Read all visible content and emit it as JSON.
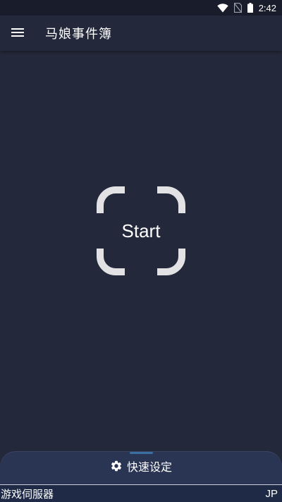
{
  "status_bar": {
    "time": "2:42",
    "icons": [
      "wifi-icon",
      "no-sim-icon",
      "battery-icon"
    ]
  },
  "app_bar": {
    "menu_icon": "hamburger-menu-icon",
    "title": "马娘事件簿"
  },
  "main": {
    "start_label": "Start",
    "frame_icon": "scan-frame-icon"
  },
  "bottom_sheet": {
    "quick_settings_icon": "gear-icon",
    "quick_settings_label": "快速设定",
    "server_label": "游戏伺服器",
    "server_value": "JP"
  },
  "colors": {
    "background": "#23283a",
    "status_bar": "#191d2b",
    "sheet": "#2a3553",
    "handle": "#3b6fa3",
    "frame": "#e2e2e4"
  }
}
